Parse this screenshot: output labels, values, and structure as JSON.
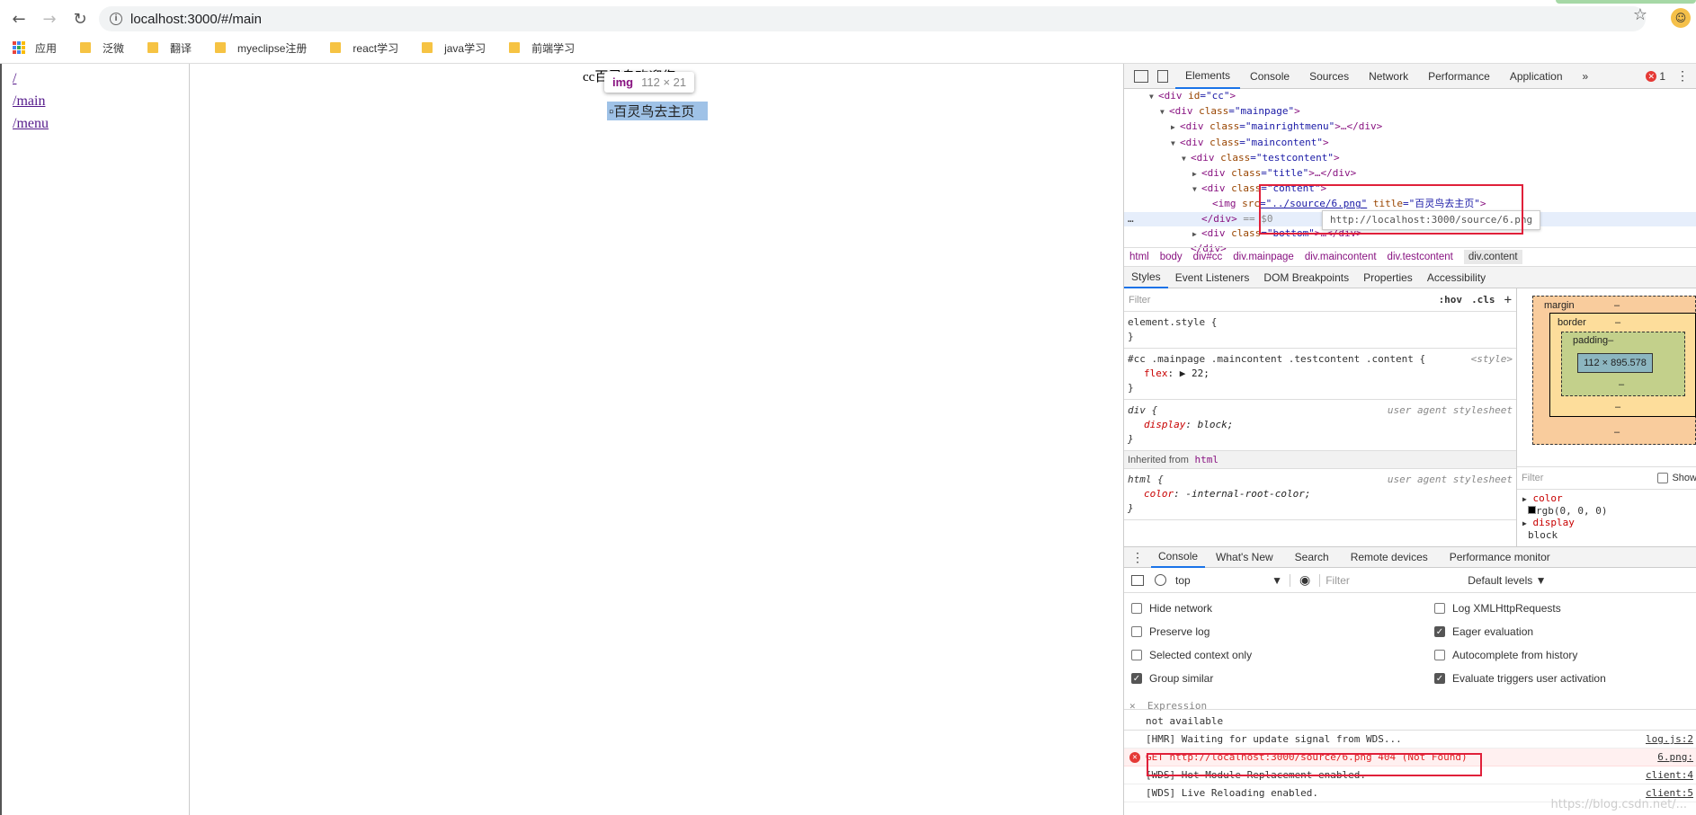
{
  "browser": {
    "url": "localhost:3000/#/main",
    "bookmarks": [
      "应用",
      "泛微",
      "翻译",
      "myeclipse注册",
      "react学习",
      "java学习",
      "前端学习"
    ]
  },
  "page": {
    "links": [
      "/",
      "/main",
      "/menu"
    ],
    "content_text": "cc百灵鸟欢迎您",
    "img_alt": "百灵鸟去主页",
    "tooltip": {
      "tag": "img",
      "size": "112 × 21"
    }
  },
  "devtools": {
    "tabs": [
      "Elements",
      "Console",
      "Sources",
      "Network",
      "Performance",
      "Application",
      "»"
    ],
    "error_count": "1",
    "dom": [
      {
        "indent": 2,
        "arrow": "▼",
        "tag": "<div",
        "attrs": [
          {
            "n": "id",
            "v": "\"cc\""
          }
        ],
        "end": ">"
      },
      {
        "indent": 3,
        "arrow": "▼",
        "tag": "<div",
        "attrs": [
          {
            "n": "class",
            "v": "\"mainpage\""
          }
        ],
        "end": ">"
      },
      {
        "indent": 4,
        "arrow": "▶",
        "tag": "<div",
        "attrs": [
          {
            "n": "class",
            "v": "\"mainrightmenu\""
          }
        ],
        "end": ">…</div>"
      },
      {
        "indent": 4,
        "arrow": "▼",
        "tag": "<div",
        "attrs": [
          {
            "n": "class",
            "v": "\"maincontent\""
          }
        ],
        "end": ">"
      },
      {
        "indent": 5,
        "arrow": "▼",
        "tag": "<div",
        "attrs": [
          {
            "n": "class",
            "v": "\"testcontent\""
          }
        ],
        "end": ">"
      },
      {
        "indent": 6,
        "arrow": "▶",
        "tag": "<div",
        "attrs": [
          {
            "n": "class",
            "v": "\"title\""
          }
        ],
        "end": ">…</div>"
      },
      {
        "indent": 6,
        "arrow": "▼",
        "tag": "<div",
        "attrs": [
          {
            "n": "class",
            "v": "\"content\""
          }
        ],
        "end": ">"
      },
      {
        "indent": 7,
        "arrow": "",
        "tag": "<img",
        "attrs": [
          {
            "n": "src",
            "v": "\"../source/6.png\""
          },
          {
            "n": "title",
            "v": "\"百灵鸟去主页\""
          }
        ],
        "end": ">"
      },
      {
        "indent": 6,
        "arrow": "",
        "tag": "</div>",
        "attrs": [],
        "end": " == $0"
      },
      {
        "indent": 6,
        "arrow": "▶",
        "tag": "<div",
        "attrs": [
          {
            "n": "class",
            "v": "\"bottom\""
          }
        ],
        "end": ">…</div>"
      },
      {
        "indent": 5,
        "arrow": "",
        "tag": "</div>",
        "attrs": [],
        "end": ""
      }
    ],
    "dom_tooltip": "http://localhost:3000/source/6.png",
    "breadcrumbs": [
      "html",
      "body",
      "div#cc",
      "div.mainpage",
      "div.maincontent",
      "div.testcontent",
      "div.content"
    ],
    "subtabs": [
      "Styles",
      "Event Listeners",
      "DOM Breakpoints",
      "Properties",
      "Accessibility"
    ],
    "styles": {
      "filter_placeholder": "Filter",
      "hov": ":hov",
      "cls": ".cls",
      "element_style": "element.style {",
      "rule1_selector": "#cc .mainpage .maincontent .testcontent .content {",
      "rule1_source": "<style>",
      "rule1_prop": "flex",
      "rule1_val": "22;",
      "rule2_selector": "div {",
      "rule2_source": "user agent stylesheet",
      "rule2_prop": "display",
      "rule2_val": "block;",
      "inherited": "Inherited from",
      "inherited_tag": "html",
      "rule3_selector": "html {",
      "rule3_source": "user agent stylesheet",
      "rule3_prop": "color",
      "rule3_val": "-internal-root-color;",
      "close_brace": "}"
    },
    "boxmodel": {
      "margin": "margin",
      "border": "border",
      "padding": "padding–",
      "content": "112 × 895.578",
      "dash": "–"
    },
    "computed": {
      "filter": "Filter",
      "show": "Show",
      "color_prop": "color",
      "color_val": "rgb(0, 0, 0)",
      "display_prop": "display",
      "display_val": "block"
    },
    "drawer_tabs": [
      "Console",
      "What's New",
      "Search",
      "Remote devices",
      "Performance monitor"
    ],
    "console": {
      "context": "top",
      "filter_placeholder": "Filter",
      "levels": "Default levels ▼",
      "settings_left": [
        {
          "label": "Hide network",
          "checked": false
        },
        {
          "label": "Preserve log",
          "checked": false
        },
        {
          "label": "Selected context only",
          "checked": false
        },
        {
          "label": "Group similar",
          "checked": true
        }
      ],
      "settings_right": [
        {
          "label": "Log XMLHttpRequests",
          "checked": false
        },
        {
          "label": "Eager evaluation",
          "checked": true
        },
        {
          "label": "Autocomplete from history",
          "checked": false
        },
        {
          "label": "Evaluate triggers user activation",
          "checked": true
        }
      ],
      "expression_label": "Expression",
      "expression_value": "not available",
      "messages": [
        {
          "text": "[HMR] Waiting for update signal from WDS...",
          "source": "log.js:2",
          "error": false
        },
        {
          "text": "GET http://localhost:3000/source/6.png 404 (Not Found)",
          "source": "6.png:",
          "error": true
        },
        {
          "text": "[WDS] Hot Module Replacement enabled.",
          "source": "client:4",
          "error": false
        },
        {
          "text": "[WDS] Live Reloading enabled.",
          "source": "client:5",
          "error": false
        }
      ]
    },
    "watermark": "https://blog.csdn.net/..."
  }
}
